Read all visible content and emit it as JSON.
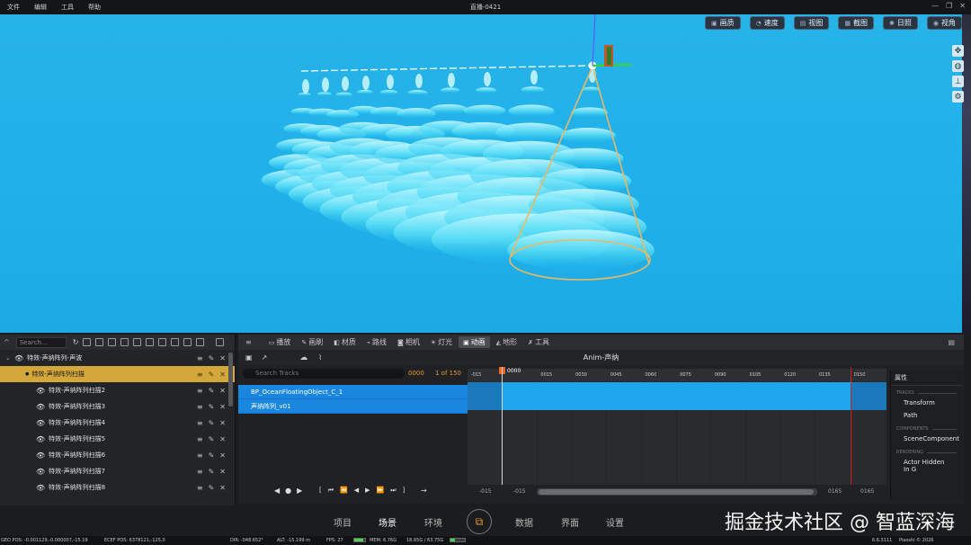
{
  "menu": [
    "文件",
    "编辑",
    "工具",
    "帮助"
  ],
  "window_title": "直播-0421",
  "window_controls": [
    "—",
    "❐",
    "✕"
  ],
  "viewport_toolbar": [
    {
      "icon": "image-icon",
      "label": "画质"
    },
    {
      "icon": "speed-icon",
      "label": "速度"
    },
    {
      "icon": "view-icon",
      "label": "视图"
    },
    {
      "icon": "screenshot-icon",
      "label": "截图"
    },
    {
      "icon": "sun-icon",
      "label": "日照"
    },
    {
      "icon": "eye-icon",
      "label": "视角"
    }
  ],
  "outliner": {
    "search_placeholder": "Search...",
    "items": [
      {
        "label": "特效-声纳阵列-声波",
        "indent": 0,
        "selected": false
      },
      {
        "label": "特效-声纳阵列扫描",
        "indent": 1,
        "selected": true
      },
      {
        "label": "特效-声纳阵列扫描2",
        "indent": 2,
        "selected": false
      },
      {
        "label": "特效-声纳阵列扫描3",
        "indent": 2,
        "selected": false
      },
      {
        "label": "特效-声纳阵列扫描4",
        "indent": 2,
        "selected": false
      },
      {
        "label": "特效-声纳阵列扫描5",
        "indent": 2,
        "selected": false
      },
      {
        "label": "特效-声纳阵列扫描6",
        "indent": 2,
        "selected": false
      },
      {
        "label": "特效-声纳阵列扫描7",
        "indent": 2,
        "selected": false
      },
      {
        "label": "特效-声纳阵列扫描8",
        "indent": 2,
        "selected": false
      }
    ]
  },
  "sequencer": {
    "tabs": [
      {
        "icon": "film-icon",
        "label": "播放",
        "active": false
      },
      {
        "icon": "brush-icon",
        "label": "画刷",
        "active": false
      },
      {
        "icon": "material-icon",
        "label": "材质",
        "active": false
      },
      {
        "icon": "path-icon",
        "label": "路线",
        "active": false
      },
      {
        "icon": "camera-icon",
        "label": "相机",
        "active": false
      },
      {
        "icon": "light-icon",
        "label": "灯光",
        "active": false
      },
      {
        "icon": "animation-icon",
        "label": "动画",
        "active": true
      },
      {
        "icon": "terrain-icon",
        "label": "地形",
        "active": false
      },
      {
        "icon": "tool-icon",
        "label": "工具",
        "active": false
      }
    ],
    "title": "Anim-声纳",
    "track_search_placeholder": "Search Tracks",
    "current_frame": "0000",
    "frame_count": "1 of 150",
    "tracks": [
      "BP_OceanFloatingObject_C_1",
      "声纳阵列_v01"
    ],
    "ruler_labels": [
      "-015",
      "0000",
      "0015",
      "0030",
      "0045",
      "0060",
      "0075",
      "0090",
      "0105",
      "0120",
      "0135",
      "0150"
    ],
    "playhead_label": "0000",
    "footer": {
      "lo": "-015",
      "lo2": "-015",
      "hi": "0165",
      "hi2": "0165"
    },
    "play_buttons_a": [
      "◀",
      "●",
      "▶"
    ],
    "play_buttons_b": [
      "[",
      "⏮",
      "⏪",
      "◀",
      "▶",
      "⏩",
      "⏭",
      "]"
    ],
    "export_button": "→"
  },
  "properties": {
    "title": "属性",
    "sections": [
      {
        "name": "TRACKS",
        "items": [
          "Transform",
          "Path"
        ]
      },
      {
        "name": "COMPONENTS",
        "items": [
          "SceneComponent"
        ]
      },
      {
        "name": "RENDERING",
        "items": [
          "Actor Hidden In G"
        ]
      }
    ]
  },
  "bottom_nav": {
    "tabs": [
      "项目",
      "场景",
      "环境",
      "数据",
      "界面",
      "设置"
    ],
    "active": "场景",
    "watermark": "掘金技术社区 @ 智蓝深海"
  },
  "statusbar": {
    "geo_pos": "GEO POS: -0.001129,-0.000007,-15.19",
    "ecef_pos": "ECEF POS: 6378121,-125,0",
    "dir": "DIR: -048.652°",
    "alt": "ALT: -15.199 m",
    "fps": "FPS: 27",
    "mem": "MEM: 6.76G",
    "mem2": "18.65G / 63.75G",
    "version": "6.6.3111",
    "copyright": "Piaoshi © 2026"
  },
  "colors": {
    "accent": "#d4a73a",
    "track_blue": "#1ea6ec",
    "viewport_sky": "#1fb0ea",
    "playhead": "#e46a2a"
  }
}
